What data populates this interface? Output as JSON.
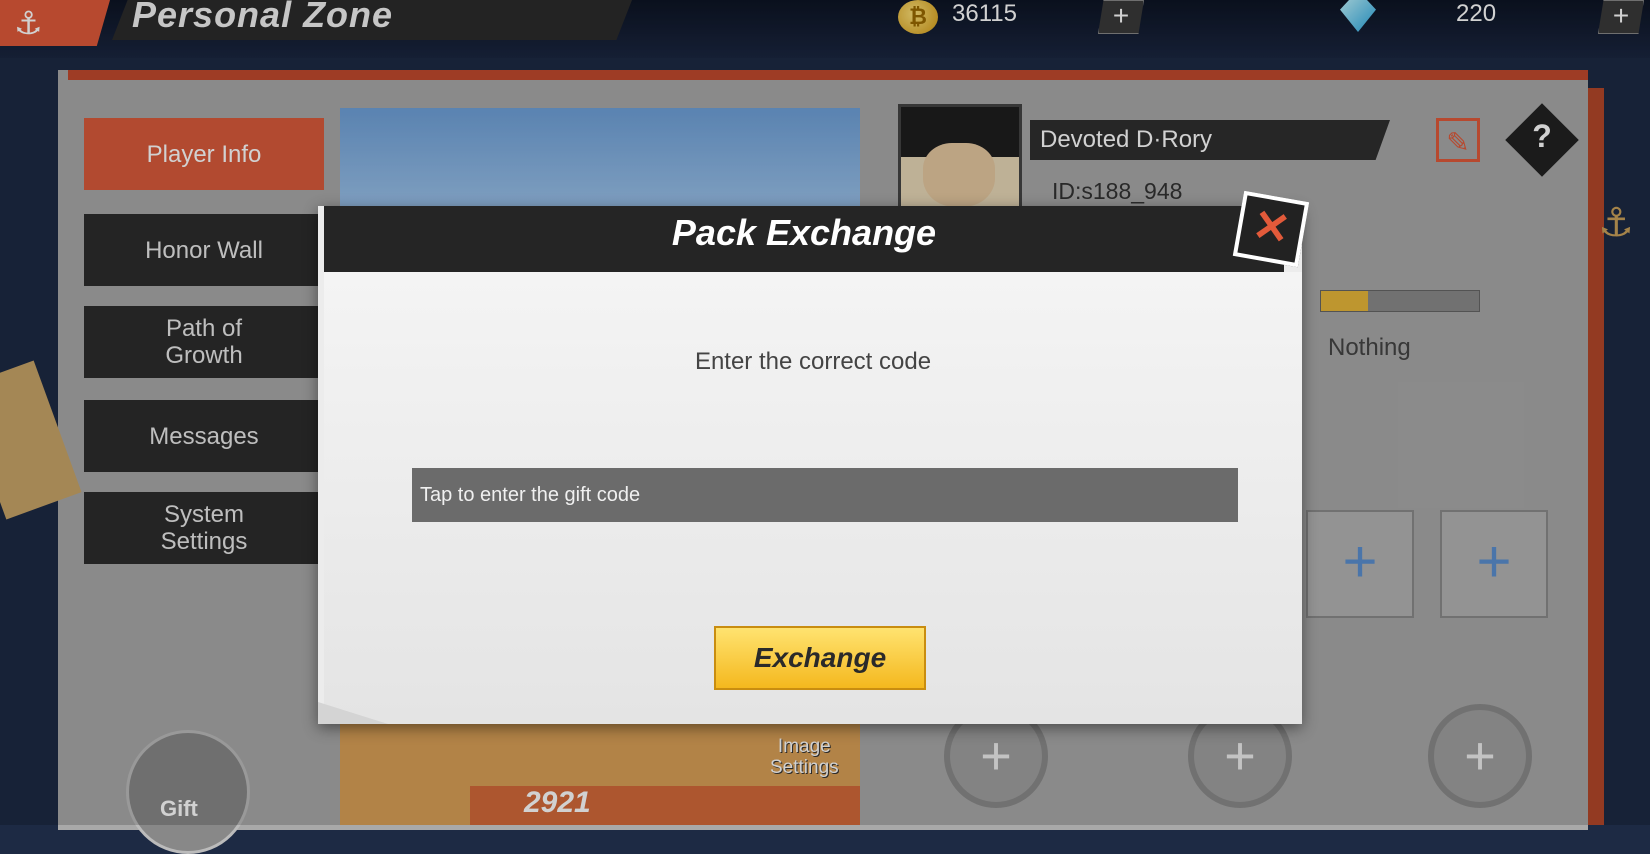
{
  "header": {
    "back_icon": "anchor-back-icon",
    "title": "Personal Zone",
    "coins": {
      "icon": "coin-icon",
      "value": "36115"
    },
    "gems": {
      "icon": "gem-icon",
      "value": "220"
    }
  },
  "sidebar": {
    "items": [
      {
        "label": "Player Info",
        "active": true
      },
      {
        "label": "Honor Wall",
        "active": false
      },
      {
        "label": "Path of\nGrowth",
        "active": false
      },
      {
        "label": "Messages",
        "active": false
      },
      {
        "label": "System\nSettings",
        "active": false
      }
    ],
    "gift_label": "Gift"
  },
  "profile": {
    "name": "Devoted D·Rory",
    "id": "ID:s188_948",
    "status_text": "Nothing",
    "progress": 0.3,
    "character_score": "2921",
    "image_settings_label": "Image\nSettings"
  },
  "modal": {
    "title": "Pack Exchange",
    "prompt": "Enter the correct code",
    "input_placeholder": "Tap to enter the gift code",
    "input_value": "",
    "button_label": "Exchange"
  },
  "colors": {
    "accent_red": "#e05a3a",
    "button_yellow": "#f7c83a",
    "header_dark": "#252525"
  }
}
